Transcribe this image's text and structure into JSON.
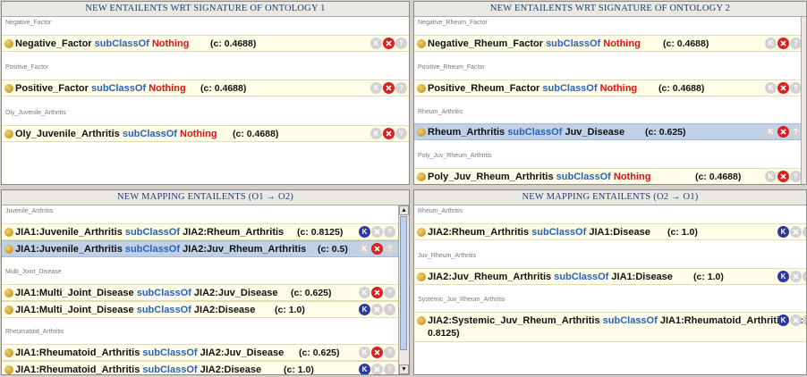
{
  "panels": {
    "ont1": {
      "title": "NEW ENTAILENTS WRT SIGNATURE OF ONTOLOGY 1",
      "sections": [
        {
          "label": "Negative_Factor",
          "rows": [
            {
              "subject": "Negative_Factor",
              "keyword": "subClassOf",
              "object": "Nothing",
              "object_red": true,
              "conf": "(c: 0.4688)"
            }
          ]
        },
        {
          "label": "Positive_Factor",
          "rows": [
            {
              "subject": "Positive_Factor",
              "keyword": "subClassOf",
              "object": "Nothing",
              "object_red": true,
              "conf": "(c: 0.4688)"
            }
          ]
        },
        {
          "label": "Oly_Juvenile_Arthritis",
          "rows": [
            {
              "subject": "Oly_Juvenile_Arthritis",
              "keyword": "subClassOf",
              "object": "Nothing",
              "object_red": true,
              "conf": "(c: 0.4688)"
            }
          ]
        }
      ]
    },
    "ont2": {
      "title": "NEW ENTAILENTS WRT SIGNATURE OF ONTOLOGY 2",
      "sections": [
        {
          "label": "Negative_Rheum_Factor",
          "rows": [
            {
              "subject": "Negative_Rheum_Factor",
              "keyword": "subClassOf",
              "object": "Nothing",
              "object_red": true,
              "conf": "(c: 0.4688)"
            }
          ]
        },
        {
          "label": "Positive_Rheum_Factor",
          "rows": [
            {
              "subject": "Positive_Rheum_Factor",
              "keyword": "subClassOf",
              "object": "Nothing",
              "object_red": true,
              "conf": "(c: 0.4688)"
            }
          ]
        },
        {
          "label": "Rheum_Arthritis",
          "rows": [
            {
              "subject": "Rheum_Arthritis",
              "keyword": "subClassOf",
              "object": "Juv_Disease",
              "object_red": false,
              "conf": "(c: 0.625)",
              "selected": true
            }
          ]
        },
        {
          "label": "Poly_Juv_Rheum_Arthritis",
          "rows": [
            {
              "subject": "Poly_Juv_Rheum_Arthritis",
              "keyword": "subClassOf",
              "object": "Nothing",
              "object_red": true,
              "conf": "(c: 0.4688)"
            }
          ]
        }
      ]
    },
    "map12": {
      "title": "NEW MAPPING ENTAILENTS  (O1 → O2)",
      "sections": [
        {
          "label": "Juvenile_Arthritis",
          "rows": [
            {
              "subject": "JIA1:Juvenile_Arthritis",
              "keyword": "subClassOf",
              "object": "JIA2:Rheum_Arthritis",
              "object_red": false,
              "conf": "(c: 0.8125)",
              "k_on": true
            },
            {
              "subject": "JIA1:Juvenile_Arthritis",
              "keyword": "subClassOf",
              "object": "JIA2:Juv_Rheum_Arthritis",
              "object_red": false,
              "conf": "(c: 0.5)",
              "x_on": true,
              "selected": true
            }
          ]
        },
        {
          "label": "Multi_Joint_Disease",
          "rows": [
            {
              "subject": "JIA1:Multi_Joint_Disease",
              "keyword": "subClassOf",
              "object": "JIA2:Juv_Disease",
              "object_red": false,
              "conf": "(c: 0.625)",
              "x_on": true
            },
            {
              "subject": "JIA1:Multi_Joint_Disease",
              "keyword": "subClassOf",
              "object": "JIA2:Disease",
              "object_red": false,
              "conf": "(c: 1.0)",
              "k_on": true
            }
          ]
        },
        {
          "label": "Rheumatoid_Arthritis",
          "rows": [
            {
              "subject": "JIA1:Rheumatoid_Arthritis",
              "keyword": "subClassOf",
              "object": "JIA2:Juv_Disease",
              "object_red": false,
              "conf": "(c: 0.625)",
              "x_on": true
            },
            {
              "subject": "JIA1:Rheumatoid_Arthritis",
              "keyword": "subClassOf",
              "object": "JIA2:Disease",
              "object_red": false,
              "conf": "(c: 1.0)",
              "k_on": true
            }
          ]
        }
      ]
    },
    "map21": {
      "title": "NEW MAPPING ENTAILENTS  (O2 → O1)",
      "sections": [
        {
          "label": "Rheum_Arthritis",
          "rows": [
            {
              "subject": "JIA2:Rheum_Arthritis",
              "keyword": "subClassOf",
              "object": "JIA1:Disease",
              "object_red": false,
              "conf": "(c: 1.0)",
              "k_on": true
            }
          ]
        },
        {
          "label": "Juv_Rheum_Arthritis",
          "rows": [
            {
              "subject": "JIA2:Juv_Rheum_Arthritis",
              "keyword": "subClassOf",
              "object": "JIA1:Disease",
              "object_red": false,
              "conf": "(c: 1.0)",
              "k_on": true
            }
          ]
        },
        {
          "label": "Systemic_Juv_Rheum_Arthritis",
          "rows": [
            {
              "subject": "JIA2:Systemic_Juv_Rheum_Arthritis",
              "keyword": "subClassOf",
              "object": "JIA1:Rheumatoid_Arthriti",
              "object_red": false,
              "conf": "(c:",
              "conf_wrap": "0.8125)",
              "k_on": true,
              "tall": true
            }
          ]
        }
      ]
    }
  },
  "icons": {
    "keep": "K",
    "reject": "x",
    "help": "?"
  },
  "colors": {
    "keyword": "#2a62b8",
    "nothing": "#e01010",
    "row": "#fffde8",
    "selected": "#bfd0e7",
    "title": "#1c3f73"
  }
}
